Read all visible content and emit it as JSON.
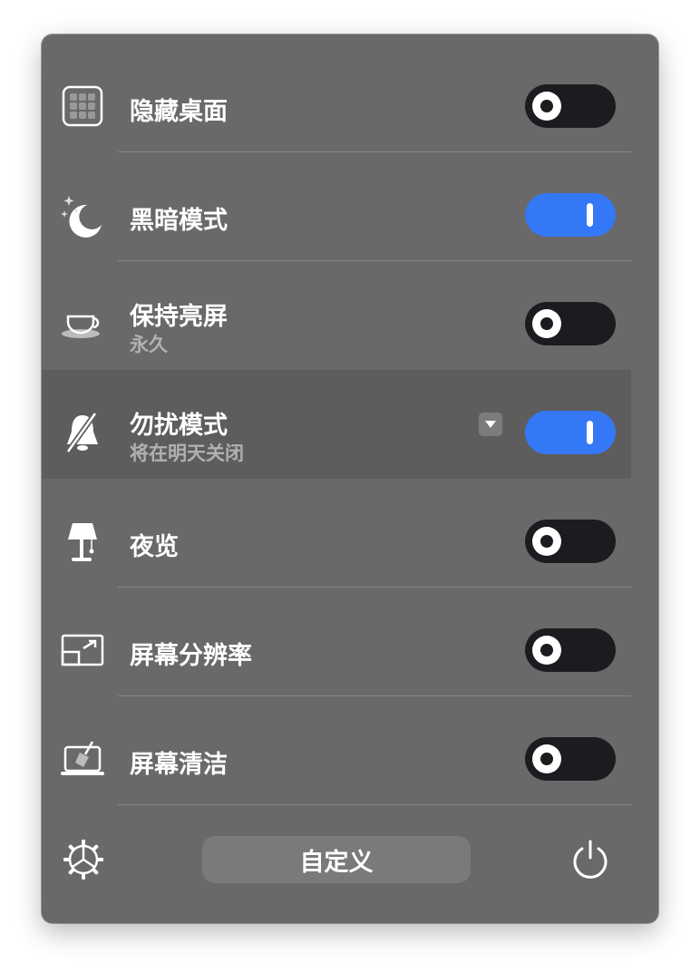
{
  "rows": [
    {
      "label": "隐藏桌面",
      "icon": "grid-icon",
      "toggle": "off"
    },
    {
      "label": "黑暗模式",
      "icon": "moon-icon",
      "toggle": "on"
    },
    {
      "label": "保持亮屏",
      "sublabel": "永久",
      "icon": "coffee-cup-icon",
      "toggle": "off"
    },
    {
      "label": "勿扰模式",
      "sublabel": "将在明天关闭",
      "icon": "bell-slash-icon",
      "toggle": "on",
      "dropdown_icon": "chevron-down-icon"
    },
    {
      "label": "夜览",
      "icon": "lamp-icon",
      "toggle": "off"
    },
    {
      "label": "屏幕分辨率",
      "icon": "resolution-icon",
      "toggle": "off"
    },
    {
      "label": "屏幕清洁",
      "icon": "laptop-broom-icon",
      "toggle": "off"
    }
  ],
  "footer": {
    "customize_label": "自定义",
    "settings_icon": "gear-icon",
    "power_icon": "power-icon"
  },
  "colors": {
    "panel": "#6a6868",
    "toggle_on": "#3478f6",
    "toggle_off": "#1c1b20"
  }
}
